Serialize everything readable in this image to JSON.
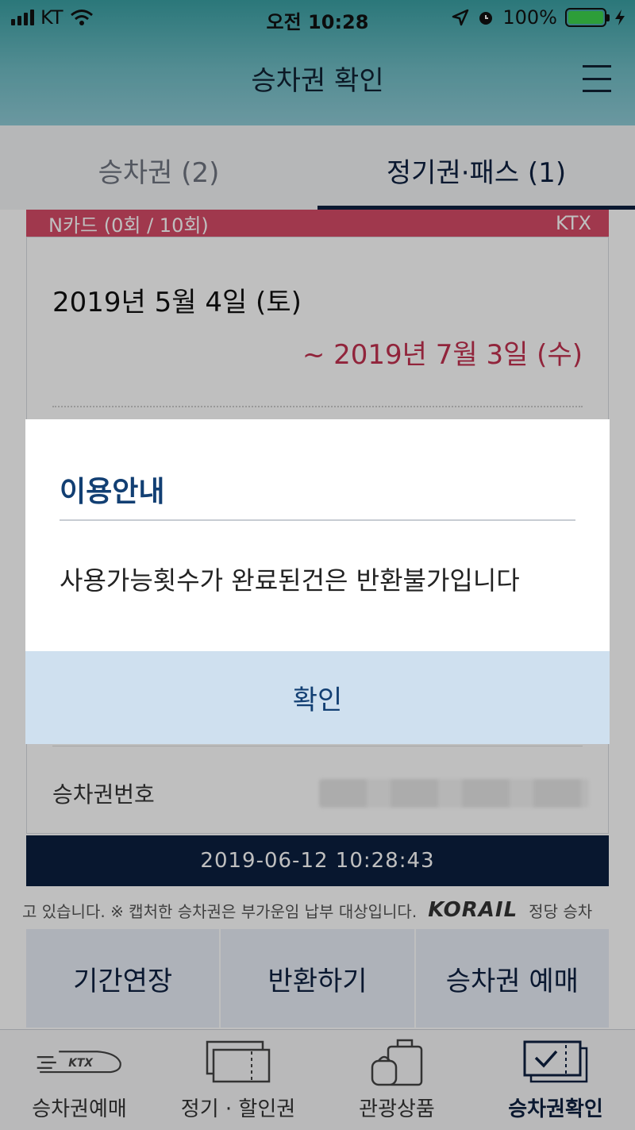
{
  "status_bar": {
    "carrier": "KT",
    "time": "오전 10:28",
    "battery": "100%"
  },
  "header": {
    "title": "승차권 확인"
  },
  "tabs": [
    {
      "label": "승차권 (2)",
      "active": false
    },
    {
      "label": "정기권·패스 (1)",
      "active": true
    }
  ],
  "card": {
    "strip_left": "N카드 (0회 / 10회)",
    "strip_right": "KTX",
    "date_start": "2019년 5월 4일 (토)",
    "date_end": "~ 2019년 7월 3일 (수)",
    "ticket_number_label": "승차권번호",
    "timestamp": "2019-06-12 10:28:43"
  },
  "notice": {
    "text": "고 있습니다. ※ 캡처한 승차권은 부가운임 납부 대상입니다.",
    "logo": "KORAIL",
    "tail": "정당 승차"
  },
  "actions": [
    {
      "label": "기간연장"
    },
    {
      "label": "반환하기"
    },
    {
      "label": "승차권 예매"
    }
  ],
  "bottom_nav": [
    {
      "label": "승차권예매",
      "icon": "ktx-train-icon",
      "active": false
    },
    {
      "label": "정기 · 할인권",
      "icon": "discount-ticket-icon",
      "active": false
    },
    {
      "label": "관광상품",
      "icon": "luggage-icon",
      "active": false
    },
    {
      "label": "승차권확인",
      "icon": "ticket-check-icon",
      "active": true
    }
  ],
  "modal": {
    "title": "이용안내",
    "message": "사용가능횟수가 완료된건은 반환불가입니다",
    "confirm_label": "확인"
  },
  "colors": {
    "accent_navy": "#0e2140",
    "header_teal": "#3aa0a3",
    "date_red": "#c2314f",
    "strip_pink": "#d64b67",
    "modal_button_bg": "#cfe0ef"
  }
}
